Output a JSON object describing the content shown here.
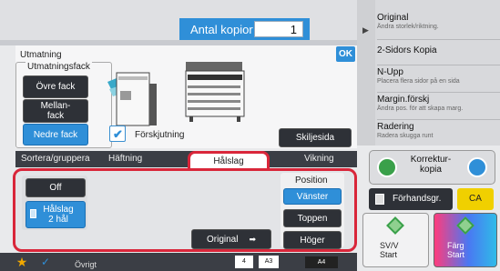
{
  "copies": {
    "label": "Antal kopior",
    "value": "1"
  },
  "ok_label": "OK",
  "output": {
    "section_label": "Utmatning",
    "tray_group_label": "Utmatningsfack",
    "trays": [
      "Övre fack",
      "Mellan-\nfack",
      "Nedre fack"
    ],
    "selected_tray": "Nedre fack"
  },
  "offset": {
    "label": "Förskjutning",
    "checked": true
  },
  "separator_label": "Skiljesida",
  "tabs": [
    "Sortera/gruppera",
    "Häftning",
    "Hålslag",
    "Vikning"
  ],
  "active_tab": "Hålslag",
  "punch": {
    "off_label": "Off",
    "two_hole_label": "Hålslag\n2 hål",
    "original_label": "Original",
    "position_label": "Position",
    "positions": [
      "Vänster",
      "Toppen",
      "Höger"
    ],
    "selected_position": "Vänster"
  },
  "sidebar": {
    "items": [
      {
        "title": "Original",
        "sub": "Ändra storlek/riktning."
      },
      {
        "title": "2-Sidors Kopia",
        "sub": ""
      },
      {
        "title": "N-Upp",
        "sub": "Placera flera sidor på en sida"
      },
      {
        "title": "Margin.förskj",
        "sub": "Ändra pos. för att skapa marg."
      },
      {
        "title": "Radering",
        "sub": "Radera skugga runt"
      }
    ],
    "correction_label": "Korrektur-\nkopia",
    "preview_label": "Förhandsgr.",
    "ca_label": "CA",
    "start_bw": "SV/V\nStart",
    "start_color": "Färg\nStart"
  },
  "bottom": {
    "other_label": "Övrigt",
    "paper_labels": [
      "4",
      "A3",
      "A4"
    ]
  },
  "colors": {
    "accent": "#2f8fd8",
    "highlight": "#d9263a",
    "ca": "#f0d000"
  }
}
